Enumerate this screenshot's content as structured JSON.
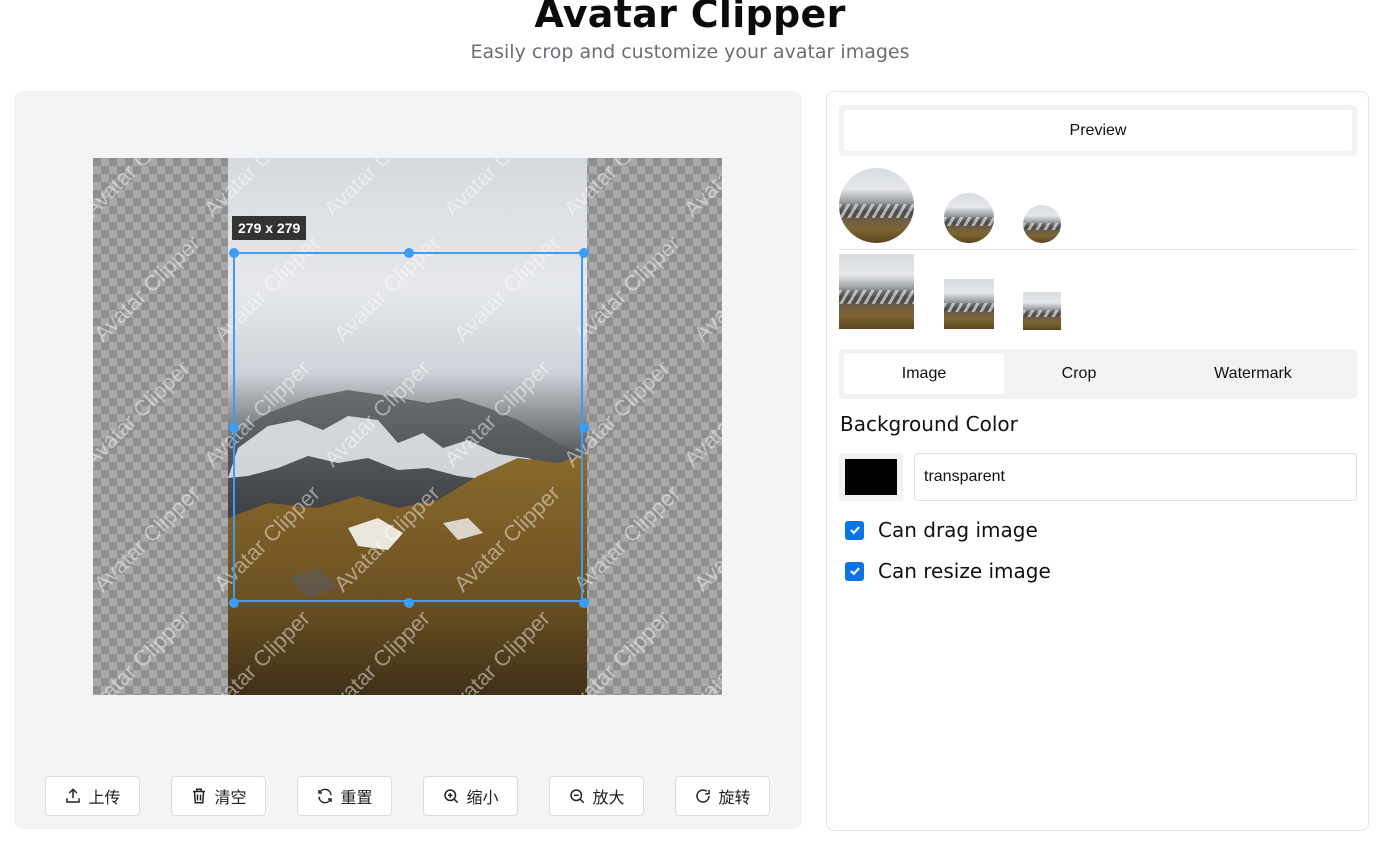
{
  "header": {
    "title": "Avatar Clipper",
    "subtitle": "Easily crop and customize your avatar images"
  },
  "editor": {
    "crop_size_label": "279 x 279",
    "watermark_text": "Avatar Clipper"
  },
  "toolbar": {
    "upload_label": "上传",
    "clear_label": "清空",
    "reset_label": "重置",
    "zoom_out_label": "缩小",
    "zoom_in_label": "放大",
    "rotate_label": "旋转"
  },
  "sidebar": {
    "preview_tab": "Preview",
    "tabs": [
      {
        "label": "Image",
        "active": true
      },
      {
        "label": "Crop",
        "active": false
      },
      {
        "label": "Watermark",
        "active": false
      }
    ],
    "background_color_label": "Background Color",
    "background_color_value": "transparent",
    "swatch_color": "#000000",
    "options": [
      {
        "label": "Can drag image",
        "checked": true
      },
      {
        "label": "Can resize image",
        "checked": true
      }
    ]
  },
  "colors": {
    "accent": "#3d9cf5",
    "checkbox": "#0b74e5",
    "panel_bg": "#f3f4f6"
  }
}
